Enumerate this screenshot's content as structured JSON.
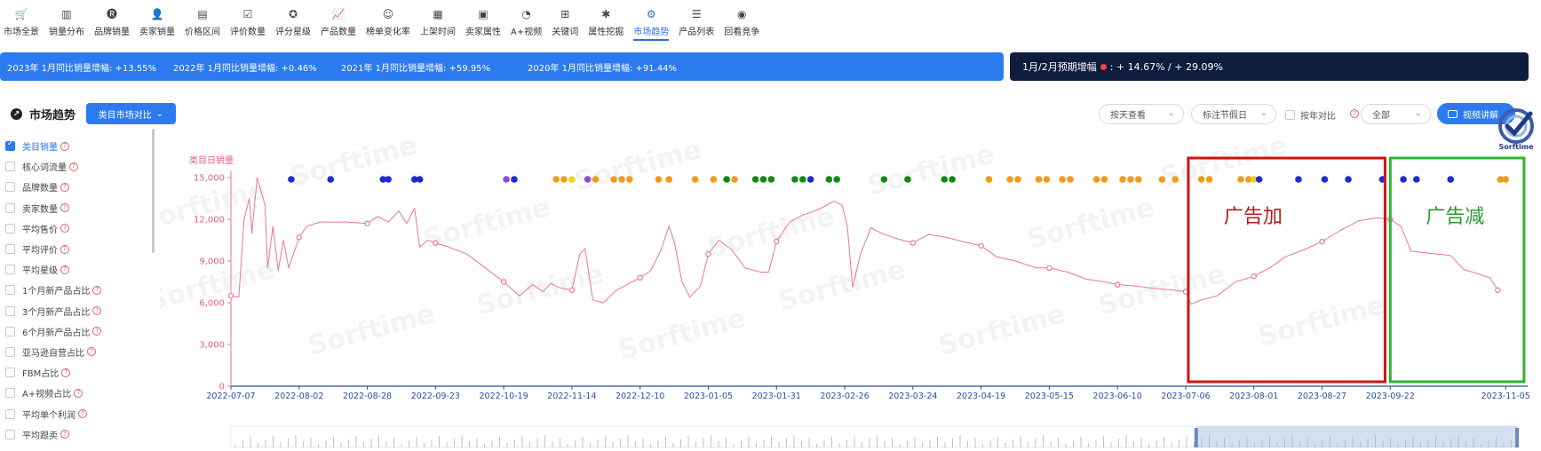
{
  "nav": {
    "items": [
      {
        "label": "市场全景",
        "icon": "cart-icon",
        "glyph": "🛒"
      },
      {
        "label": "销量分布",
        "icon": "bar-chart-icon",
        "glyph": "▥"
      },
      {
        "label": "品牌销量",
        "icon": "brand-badge-icon",
        "glyph": "🅡"
      },
      {
        "label": "卖家销量",
        "icon": "seller-icon",
        "glyph": "👤"
      },
      {
        "label": "价格区间",
        "icon": "price-tag-icon",
        "glyph": "▤"
      },
      {
        "label": "评价数量",
        "icon": "review-icon",
        "glyph": "☑"
      },
      {
        "label": "评分星级",
        "icon": "star-icon",
        "glyph": "✪"
      },
      {
        "label": "产品数量",
        "icon": "line-chart-icon",
        "glyph": "📈"
      },
      {
        "label": "榜单变化率",
        "icon": "smile-icon",
        "glyph": "☺"
      },
      {
        "label": "上架时间",
        "icon": "calendar-icon",
        "glyph": "▦"
      },
      {
        "label": "卖家属性",
        "icon": "shop-icon",
        "glyph": "▣"
      },
      {
        "label": "A+视频",
        "icon": "pie-icon",
        "glyph": "◔"
      },
      {
        "label": "关键词",
        "icon": "keyword-grid-icon",
        "glyph": "⊞"
      },
      {
        "label": "属性挖掘",
        "icon": "puzzle-icon",
        "glyph": "✱"
      },
      {
        "label": "市场趋势",
        "icon": "trend-icon",
        "glyph": "⚙",
        "active": true
      },
      {
        "label": "产品列表",
        "icon": "list-icon",
        "glyph": "☰"
      },
      {
        "label": "回看竞争",
        "icon": "target-icon",
        "glyph": "◉"
      }
    ]
  },
  "growth": {
    "items": [
      "2023年 1月同比销量增幅: +13.55%",
      "2022年 1月同比销量增幅: +0.46%",
      "2021年 1月同比销量增幅: +59.95%",
      "2020年 1月同比销量增幅: +91.44%"
    ],
    "forecast_label": "1月/2月预期增幅",
    "forecast_value": ": + 14.67% / + 29.09%"
  },
  "controls": {
    "title": "市场趋势",
    "compare_button": "类目市场对比",
    "view_select": "按天查看",
    "holiday_select": "标注节假日",
    "yoy_label": "按年对比",
    "range_select": "全部",
    "video_button": "视频讲解",
    "logo_text": "Sorftime"
  },
  "metrics": [
    {
      "label": "类目销量",
      "checked": true
    },
    {
      "label": "核心词流量"
    },
    {
      "label": "品牌数量"
    },
    {
      "label": "卖家数量"
    },
    {
      "label": "平均售价"
    },
    {
      "label": "平均评价"
    },
    {
      "label": "平均星级"
    },
    {
      "label": "1个月新产品占比"
    },
    {
      "label": "3个月新产品占比"
    },
    {
      "label": "6个月新产品占比"
    },
    {
      "label": "亚马逊自营占比"
    },
    {
      "label": "FBM占比"
    },
    {
      "label": "A+视频占比"
    },
    {
      "label": "平均单个利润"
    },
    {
      "label": "平均跟卖"
    }
  ],
  "chart_data": {
    "type": "line",
    "ylabel": "类目日销量",
    "ylim": [
      0,
      15000
    ],
    "yticks": [
      0,
      3000,
      6000,
      9000,
      12000,
      15000
    ],
    "ytick_labels": [
      "0",
      "3,000",
      "6,000",
      "9,000",
      "12,000",
      "15,000"
    ],
    "x_dates": [
      "2022-07-07",
      "2022-08-02",
      "2022-08-28",
      "2022-09-23",
      "2022-10-19",
      "2022-11-14",
      "2022-12-10",
      "2023-01-05",
      "2023-01-31",
      "2023-02-26",
      "2023-03-24",
      "2023-04-19",
      "2023-05-15",
      "2023-06-10",
      "2023-07-06",
      "2023-08-01",
      "2023-08-27",
      "2023-09-22",
      "2023-11-05"
    ],
    "series": [
      {
        "color": "#e8788e",
        "points": [
          [
            "2022-07-07",
            6500
          ],
          [
            "2022-07-10",
            6400
          ],
          [
            "2022-07-12",
            12000
          ],
          [
            "2022-07-14",
            13500
          ],
          [
            "2022-07-15",
            11000
          ],
          [
            "2022-07-17",
            15000
          ],
          [
            "2022-07-20",
            13000
          ],
          [
            "2022-07-21",
            8500
          ],
          [
            "2022-07-23",
            11500
          ],
          [
            "2022-07-25",
            8300
          ],
          [
            "2022-07-27",
            10500
          ],
          [
            "2022-07-29",
            8500
          ],
          [
            "2022-08-02",
            10700
          ],
          [
            "2022-08-05",
            11500
          ],
          [
            "2022-08-10",
            11800
          ],
          [
            "2022-08-20",
            11800
          ],
          [
            "2022-08-28",
            11700
          ],
          [
            "2022-09-01",
            12200
          ],
          [
            "2022-09-05",
            11800
          ],
          [
            "2022-09-09",
            12600
          ],
          [
            "2022-09-12",
            11700
          ],
          [
            "2022-09-15",
            12800
          ],
          [
            "2022-09-17",
            10000
          ],
          [
            "2022-09-20",
            10500
          ],
          [
            "2022-09-23",
            10300
          ],
          [
            "2022-09-28",
            10000
          ],
          [
            "2022-10-05",
            9500
          ],
          [
            "2022-10-12",
            8500
          ],
          [
            "2022-10-19",
            7500
          ],
          [
            "2022-10-25",
            6500
          ],
          [
            "2022-10-30",
            7300
          ],
          [
            "2022-11-03",
            6800
          ],
          [
            "2022-11-06",
            7400
          ],
          [
            "2022-11-09",
            7100
          ],
          [
            "2022-11-14",
            6900
          ],
          [
            "2022-11-17",
            9500
          ],
          [
            "2022-11-19",
            9900
          ],
          [
            "2022-11-22",
            6200
          ],
          [
            "2022-11-26",
            6000
          ],
          [
            "2022-12-01",
            6900
          ],
          [
            "2022-12-06",
            7400
          ],
          [
            "2022-12-10",
            7800
          ],
          [
            "2022-12-14",
            8300
          ],
          [
            "2022-12-18",
            9800
          ],
          [
            "2022-12-21",
            11500
          ],
          [
            "2022-12-23",
            10400
          ],
          [
            "2022-12-26",
            7500
          ],
          [
            "2022-12-29",
            6400
          ],
          [
            "2023-01-02",
            7200
          ],
          [
            "2023-01-05",
            9500
          ],
          [
            "2023-01-09",
            10500
          ],
          [
            "2023-01-14",
            9800
          ],
          [
            "2023-01-19",
            8500
          ],
          [
            "2023-01-25",
            8200
          ],
          [
            "2023-01-28",
            8200
          ],
          [
            "2023-01-31",
            10400
          ],
          [
            "2023-02-05",
            11800
          ],
          [
            "2023-02-10",
            12300
          ],
          [
            "2023-02-16",
            12700
          ],
          [
            "2023-02-22",
            13300
          ],
          [
            "2023-02-25",
            13000
          ],
          [
            "2023-02-27",
            11500
          ],
          [
            "2023-03-01",
            7100
          ],
          [
            "2023-03-04",
            9500
          ],
          [
            "2023-03-08",
            11400
          ],
          [
            "2023-03-12",
            11000
          ],
          [
            "2023-03-18",
            10600
          ],
          [
            "2023-03-24",
            10300
          ],
          [
            "2023-03-30",
            10900
          ],
          [
            "2023-04-06",
            10700
          ],
          [
            "2023-04-12",
            10400
          ],
          [
            "2023-04-19",
            10100
          ],
          [
            "2023-04-25",
            9300
          ],
          [
            "2023-05-02",
            9000
          ],
          [
            "2023-05-10",
            8500
          ],
          [
            "2023-05-15",
            8500
          ],
          [
            "2023-05-22",
            8200
          ],
          [
            "2023-05-29",
            7700
          ],
          [
            "2023-06-05",
            7500
          ],
          [
            "2023-06-10",
            7300
          ],
          [
            "2023-06-17",
            7200
          ],
          [
            "2023-06-25",
            7000
          ],
          [
            "2023-07-02",
            6900
          ],
          [
            "2023-07-06",
            6800
          ],
          [
            "2023-07-08",
            5900
          ],
          [
            "2023-07-12",
            6200
          ],
          [
            "2023-07-18",
            6500
          ],
          [
            "2023-07-25",
            7500
          ],
          [
            "2023-08-01",
            7900
          ],
          [
            "2023-08-07",
            8500
          ],
          [
            "2023-08-13",
            9300
          ],
          [
            "2023-08-20",
            9800
          ],
          [
            "2023-08-27",
            10400
          ],
          [
            "2023-09-03",
            11200
          ],
          [
            "2023-09-10",
            11900
          ],
          [
            "2023-09-17",
            12100
          ],
          [
            "2023-09-22",
            12000
          ],
          [
            "2023-09-26",
            11500
          ],
          [
            "2023-09-30",
            9700
          ],
          [
            "2023-10-05",
            9600
          ],
          [
            "2023-10-10",
            9500
          ],
          [
            "2023-10-15",
            9400
          ],
          [
            "2023-10-20",
            8400
          ],
          [
            "2023-10-25",
            8100
          ],
          [
            "2023-10-30",
            7800
          ],
          [
            "2023-11-02",
            6900
          ]
        ],
        "markers": [
          "2022-07-07",
          "2022-08-02",
          "2022-08-28",
          "2022-09-23",
          "2022-10-19",
          "2022-11-14",
          "2022-12-10",
          "2023-01-05",
          "2023-01-31",
          "2023-02-26",
          "2023-03-24",
          "2023-04-19",
          "2023-05-15",
          "2023-06-10",
          "2023-07-06",
          "2023-08-01",
          "2023-08-27",
          "2023-09-22",
          "2023-11-02"
        ]
      }
    ],
    "event_dots": [
      {
        "d": "2022-07-30",
        "c": "#1d2ad8"
      },
      {
        "d": "2022-08-14",
        "c": "#1d2ad8"
      },
      {
        "d": "2022-09-03",
        "c": "#1d2ad8"
      },
      {
        "d": "2022-09-05",
        "c": "#1d2ad8"
      },
      {
        "d": "2022-09-15",
        "c": "#1d2ad8"
      },
      {
        "d": "2022-09-17",
        "c": "#1d2ad8"
      },
      {
        "d": "2022-10-20",
        "c": "#8b4fd8"
      },
      {
        "d": "2022-10-23",
        "c": "#1d2ad8"
      },
      {
        "d": "2022-11-08",
        "c": "#f29a1c"
      },
      {
        "d": "2022-11-11",
        "c": "#f29a1c"
      },
      {
        "d": "2022-11-14",
        "c": "#f0d020"
      },
      {
        "d": "2022-11-20",
        "c": "#8b4fd8"
      },
      {
        "d": "2022-11-23",
        "c": "#f29a1c"
      },
      {
        "d": "2022-11-30",
        "c": "#f29a1c"
      },
      {
        "d": "2022-12-03",
        "c": "#f29a1c"
      },
      {
        "d": "2022-12-06",
        "c": "#f29a1c"
      },
      {
        "d": "2022-12-17",
        "c": "#f29a1c"
      },
      {
        "d": "2022-12-21",
        "c": "#f29a1c"
      },
      {
        "d": "2022-12-31",
        "c": "#f29a1c"
      },
      {
        "d": "2023-01-07",
        "c": "#f29a1c"
      },
      {
        "d": "2023-01-12",
        "c": "#0f8a0f"
      },
      {
        "d": "2023-01-15",
        "c": "#f29a1c"
      },
      {
        "d": "2023-01-23",
        "c": "#0f8a0f"
      },
      {
        "d": "2023-01-26",
        "c": "#0f8a0f"
      },
      {
        "d": "2023-01-29",
        "c": "#0f8a0f"
      },
      {
        "d": "2023-02-07",
        "c": "#0f8a0f"
      },
      {
        "d": "2023-02-10",
        "c": "#0f8a0f"
      },
      {
        "d": "2023-02-13",
        "c": "#1d2ad8"
      },
      {
        "d": "2023-02-20",
        "c": "#0f8a0f"
      },
      {
        "d": "2023-02-23",
        "c": "#0f8a0f"
      },
      {
        "d": "2023-03-13",
        "c": "#0f8a0f"
      },
      {
        "d": "2023-03-22",
        "c": "#0f8a0f"
      },
      {
        "d": "2023-04-05",
        "c": "#0f8a0f"
      },
      {
        "d": "2023-04-08",
        "c": "#0f8a0f"
      },
      {
        "d": "2023-04-22",
        "c": "#f29a1c"
      },
      {
        "d": "2023-04-30",
        "c": "#f29a1c"
      },
      {
        "d": "2023-05-03",
        "c": "#f29a1c"
      },
      {
        "d": "2023-05-11",
        "c": "#f29a1c"
      },
      {
        "d": "2023-05-14",
        "c": "#f29a1c"
      },
      {
        "d": "2023-05-20",
        "c": "#f29a1c"
      },
      {
        "d": "2023-05-23",
        "c": "#f29a1c"
      },
      {
        "d": "2023-06-02",
        "c": "#f29a1c"
      },
      {
        "d": "2023-06-05",
        "c": "#f29a1c"
      },
      {
        "d": "2023-06-12",
        "c": "#f29a1c"
      },
      {
        "d": "2023-06-15",
        "c": "#f29a1c"
      },
      {
        "d": "2023-06-18",
        "c": "#f29a1c"
      },
      {
        "d": "2023-06-27",
        "c": "#f29a1c"
      },
      {
        "d": "2023-07-02",
        "c": "#f29a1c"
      },
      {
        "d": "2023-07-12",
        "c": "#f29a1c"
      },
      {
        "d": "2023-07-15",
        "c": "#f29a1c"
      },
      {
        "d": "2023-07-27",
        "c": "#f29a1c"
      },
      {
        "d": "2023-07-30",
        "c": "#f29a1c"
      },
      {
        "d": "2023-08-01",
        "c": "#f0d020"
      },
      {
        "d": "2023-08-03",
        "c": "#1d2ad8"
      },
      {
        "d": "2023-08-18",
        "c": "#1d2ad8"
      },
      {
        "d": "2023-08-28",
        "c": "#1d2ad8"
      },
      {
        "d": "2023-09-06",
        "c": "#1d2ad8"
      },
      {
        "d": "2023-09-19",
        "c": "#1d2ad8"
      },
      {
        "d": "2023-09-27",
        "c": "#1d2ad8"
      },
      {
        "d": "2023-10-02",
        "c": "#1d2ad8"
      },
      {
        "d": "2023-10-15",
        "c": "#1d2ad8"
      },
      {
        "d": "2023-11-03",
        "c": "#f29a1c"
      },
      {
        "d": "2023-11-05",
        "c": "#f29a1c"
      }
    ],
    "annotations": [
      {
        "text": "广告加",
        "from": "2023-07-07",
        "to": "2023-09-20",
        "color": "#d41111",
        "text_color": "#b02020"
      },
      {
        "text": "广告减",
        "from": "2023-09-22",
        "to": "2023-11-12",
        "color": "#2fb32f",
        "text_color": "#2a9a2a"
      }
    ],
    "watermark": "Sorftime",
    "grid": false
  }
}
